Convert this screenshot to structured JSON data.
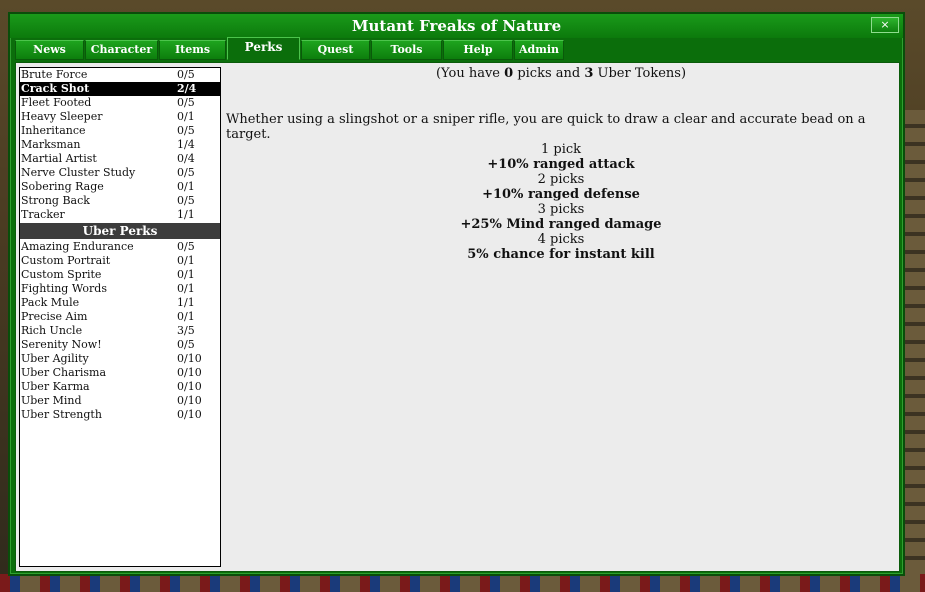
{
  "window": {
    "title": "Mutant Freaks of Nature",
    "close_label": "×"
  },
  "tabs": [
    {
      "label": "News",
      "active": false
    },
    {
      "label": "Character",
      "active": false
    },
    {
      "label": "Items",
      "active": false
    },
    {
      "label": "Perks",
      "active": true
    },
    {
      "label": "Quest",
      "active": false
    },
    {
      "label": "Tools",
      "active": false
    },
    {
      "label": "Help",
      "active": false
    },
    {
      "label": "Admin",
      "active": false
    }
  ],
  "perks": [
    {
      "name": "Brute Force",
      "value": "0/5"
    },
    {
      "name": "Crack Shot",
      "value": "2/4",
      "selected": true
    },
    {
      "name": "Fleet Footed",
      "value": "0/5"
    },
    {
      "name": "Heavy Sleeper",
      "value": "0/1"
    },
    {
      "name": "Inheritance",
      "value": "0/5"
    },
    {
      "name": "Marksman",
      "value": "1/4"
    },
    {
      "name": "Martial Artist",
      "value": "0/4"
    },
    {
      "name": "Nerve Cluster Study",
      "value": "0/5"
    },
    {
      "name": "Sobering Rage",
      "value": "0/1"
    },
    {
      "name": "Strong Back",
      "value": "0/5"
    },
    {
      "name": "Tracker",
      "value": "1/1"
    }
  ],
  "uber_header": "Uber Perks",
  "uber_perks": [
    {
      "name": "Amazing Endurance",
      "value": "0/5"
    },
    {
      "name": "Custom Portrait",
      "value": "0/1"
    },
    {
      "name": "Custom Sprite",
      "value": "0/1"
    },
    {
      "name": "Fighting Words",
      "value": "0/1"
    },
    {
      "name": "Pack Mule",
      "value": "1/1"
    },
    {
      "name": "Precise Aim",
      "value": "0/1"
    },
    {
      "name": "Rich Uncle",
      "value": "3/5"
    },
    {
      "name": "Serenity Now!",
      "value": "0/5"
    },
    {
      "name": "Uber Agility",
      "value": "0/10"
    },
    {
      "name": "Uber Charisma",
      "value": "0/10"
    },
    {
      "name": "Uber Karma",
      "value": "0/10"
    },
    {
      "name": "Uber Mind",
      "value": "0/10"
    },
    {
      "name": "Uber Strength",
      "value": "0/10"
    }
  ],
  "detail": {
    "picks_prefix": "(You have ",
    "picks_count": "0",
    "picks_middle": " picks and ",
    "tokens_count": "3",
    "picks_suffix": " Uber Tokens)",
    "description": "Whether using a slingshot or a sniper rifle, you are quick to draw a clear and accurate bead on a target.",
    "tiers": [
      {
        "label": "1 pick",
        "effect": "+10% ranged attack"
      },
      {
        "label": "2 picks",
        "effect": "+10% ranged defense"
      },
      {
        "label": "3 picks",
        "effect": "+25% Mind ranged damage"
      },
      {
        "label": "4 picks",
        "effect": "5% chance for instant kill"
      }
    ]
  }
}
